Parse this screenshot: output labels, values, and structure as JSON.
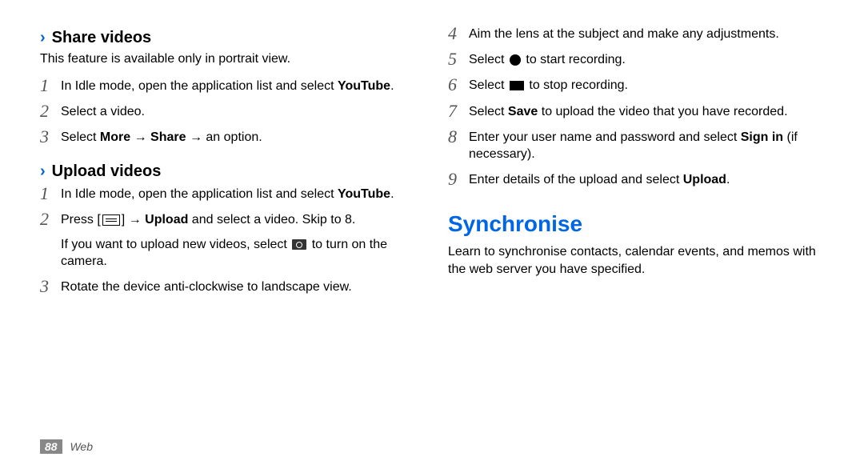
{
  "left": {
    "share": {
      "chevron": "›",
      "title": "Share videos",
      "intro": "This feature is available only in portrait view.",
      "steps": {
        "s1": {
          "num": "1",
          "a": "In Idle mode, open the application list and select ",
          "b": "YouTube",
          "c": "."
        },
        "s2": {
          "num": "2",
          "t": "Select a video."
        },
        "s3": {
          "num": "3",
          "a": "Select ",
          "b": "More",
          "c": " → ",
          "d": "Share",
          "e": " → an option."
        }
      }
    },
    "upload": {
      "chevron": "›",
      "title": "Upload videos",
      "steps": {
        "s1": {
          "num": "1",
          "a": "In Idle mode, open the application list and select ",
          "b": "YouTube",
          "c": "."
        },
        "s2": {
          "num": "2",
          "a": "Press [",
          "b": "] → ",
          "c": "Upload",
          "d": " and select a video. Skip to 8.",
          "sub_a": "If you want to upload new videos, select ",
          "sub_b": " to turn on the camera."
        },
        "s3": {
          "num": "3",
          "t": "Rotate the device anti-clockwise to landscape view."
        }
      }
    }
  },
  "right": {
    "steps": {
      "s4": {
        "num": "4",
        "t": "Aim the lens at the subject and make any adjustments."
      },
      "s5": {
        "num": "5",
        "a": "Select ",
        "b": " to start recording."
      },
      "s6": {
        "num": "6",
        "a": "Select ",
        "b": " to stop recording."
      },
      "s7": {
        "num": "7",
        "a": "Select ",
        "b": "Save",
        "c": " to upload the video that you have recorded."
      },
      "s8": {
        "num": "8",
        "a": "Enter your user name and password and select ",
        "b": "Sign in",
        "c": " (if necessary)."
      },
      "s9": {
        "num": "9",
        "a": "Enter details of the upload and select ",
        "b": "Upload",
        "c": "."
      }
    },
    "sync": {
      "title": "Synchronise",
      "intro": "Learn to synchronise contacts, calendar events, and memos with the web server you have specified."
    }
  },
  "footer": {
    "page": "88",
    "label": "Web"
  }
}
